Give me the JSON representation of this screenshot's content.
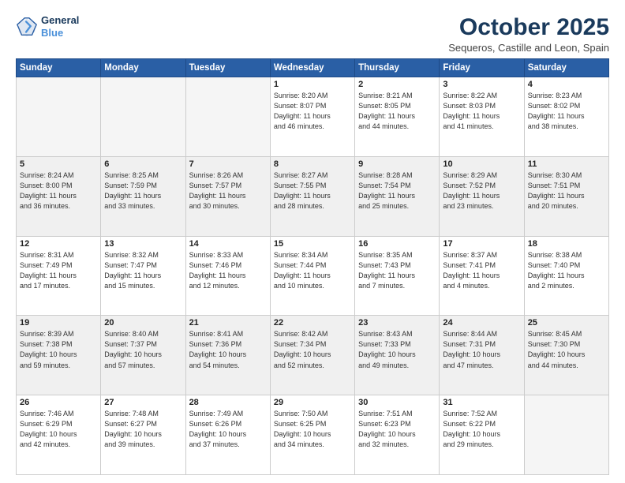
{
  "logo": {
    "line1": "General",
    "line2": "Blue"
  },
  "title": "October 2025",
  "subtitle": "Sequeros, Castille and Leon, Spain",
  "weekdays": [
    "Sunday",
    "Monday",
    "Tuesday",
    "Wednesday",
    "Thursday",
    "Friday",
    "Saturday"
  ],
  "weeks": [
    [
      {
        "day": "",
        "info": ""
      },
      {
        "day": "",
        "info": ""
      },
      {
        "day": "",
        "info": ""
      },
      {
        "day": "1",
        "info": "Sunrise: 8:20 AM\nSunset: 8:07 PM\nDaylight: 11 hours\nand 46 minutes."
      },
      {
        "day": "2",
        "info": "Sunrise: 8:21 AM\nSunset: 8:05 PM\nDaylight: 11 hours\nand 44 minutes."
      },
      {
        "day": "3",
        "info": "Sunrise: 8:22 AM\nSunset: 8:03 PM\nDaylight: 11 hours\nand 41 minutes."
      },
      {
        "day": "4",
        "info": "Sunrise: 8:23 AM\nSunset: 8:02 PM\nDaylight: 11 hours\nand 38 minutes."
      }
    ],
    [
      {
        "day": "5",
        "info": "Sunrise: 8:24 AM\nSunset: 8:00 PM\nDaylight: 11 hours\nand 36 minutes."
      },
      {
        "day": "6",
        "info": "Sunrise: 8:25 AM\nSunset: 7:59 PM\nDaylight: 11 hours\nand 33 minutes."
      },
      {
        "day": "7",
        "info": "Sunrise: 8:26 AM\nSunset: 7:57 PM\nDaylight: 11 hours\nand 30 minutes."
      },
      {
        "day": "8",
        "info": "Sunrise: 8:27 AM\nSunset: 7:55 PM\nDaylight: 11 hours\nand 28 minutes."
      },
      {
        "day": "9",
        "info": "Sunrise: 8:28 AM\nSunset: 7:54 PM\nDaylight: 11 hours\nand 25 minutes."
      },
      {
        "day": "10",
        "info": "Sunrise: 8:29 AM\nSunset: 7:52 PM\nDaylight: 11 hours\nand 23 minutes."
      },
      {
        "day": "11",
        "info": "Sunrise: 8:30 AM\nSunset: 7:51 PM\nDaylight: 11 hours\nand 20 minutes."
      }
    ],
    [
      {
        "day": "12",
        "info": "Sunrise: 8:31 AM\nSunset: 7:49 PM\nDaylight: 11 hours\nand 17 minutes."
      },
      {
        "day": "13",
        "info": "Sunrise: 8:32 AM\nSunset: 7:47 PM\nDaylight: 11 hours\nand 15 minutes."
      },
      {
        "day": "14",
        "info": "Sunrise: 8:33 AM\nSunset: 7:46 PM\nDaylight: 11 hours\nand 12 minutes."
      },
      {
        "day": "15",
        "info": "Sunrise: 8:34 AM\nSunset: 7:44 PM\nDaylight: 11 hours\nand 10 minutes."
      },
      {
        "day": "16",
        "info": "Sunrise: 8:35 AM\nSunset: 7:43 PM\nDaylight: 11 hours\nand 7 minutes."
      },
      {
        "day": "17",
        "info": "Sunrise: 8:37 AM\nSunset: 7:41 PM\nDaylight: 11 hours\nand 4 minutes."
      },
      {
        "day": "18",
        "info": "Sunrise: 8:38 AM\nSunset: 7:40 PM\nDaylight: 11 hours\nand 2 minutes."
      }
    ],
    [
      {
        "day": "19",
        "info": "Sunrise: 8:39 AM\nSunset: 7:38 PM\nDaylight: 10 hours\nand 59 minutes."
      },
      {
        "day": "20",
        "info": "Sunrise: 8:40 AM\nSunset: 7:37 PM\nDaylight: 10 hours\nand 57 minutes."
      },
      {
        "day": "21",
        "info": "Sunrise: 8:41 AM\nSunset: 7:36 PM\nDaylight: 10 hours\nand 54 minutes."
      },
      {
        "day": "22",
        "info": "Sunrise: 8:42 AM\nSunset: 7:34 PM\nDaylight: 10 hours\nand 52 minutes."
      },
      {
        "day": "23",
        "info": "Sunrise: 8:43 AM\nSunset: 7:33 PM\nDaylight: 10 hours\nand 49 minutes."
      },
      {
        "day": "24",
        "info": "Sunrise: 8:44 AM\nSunset: 7:31 PM\nDaylight: 10 hours\nand 47 minutes."
      },
      {
        "day": "25",
        "info": "Sunrise: 8:45 AM\nSunset: 7:30 PM\nDaylight: 10 hours\nand 44 minutes."
      }
    ],
    [
      {
        "day": "26",
        "info": "Sunrise: 7:46 AM\nSunset: 6:29 PM\nDaylight: 10 hours\nand 42 minutes."
      },
      {
        "day": "27",
        "info": "Sunrise: 7:48 AM\nSunset: 6:27 PM\nDaylight: 10 hours\nand 39 minutes."
      },
      {
        "day": "28",
        "info": "Sunrise: 7:49 AM\nSunset: 6:26 PM\nDaylight: 10 hours\nand 37 minutes."
      },
      {
        "day": "29",
        "info": "Sunrise: 7:50 AM\nSunset: 6:25 PM\nDaylight: 10 hours\nand 34 minutes."
      },
      {
        "day": "30",
        "info": "Sunrise: 7:51 AM\nSunset: 6:23 PM\nDaylight: 10 hours\nand 32 minutes."
      },
      {
        "day": "31",
        "info": "Sunrise: 7:52 AM\nSunset: 6:22 PM\nDaylight: 10 hours\nand 29 minutes."
      },
      {
        "day": "",
        "info": ""
      }
    ]
  ]
}
